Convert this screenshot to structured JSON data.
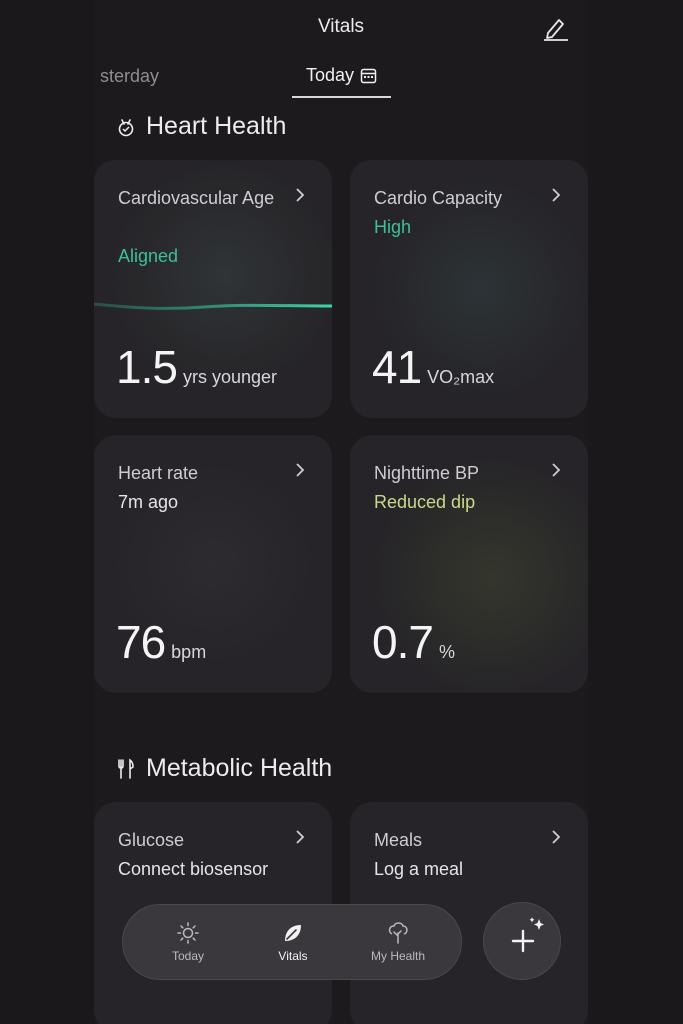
{
  "header": {
    "title": "Vitals",
    "edit_icon": "pencil-icon"
  },
  "day_tabs": {
    "yesterday": "sterday",
    "today": "Today"
  },
  "heart_health": {
    "title": "Heart Health",
    "icon": "heart-health-icon",
    "cards": [
      {
        "title": "Cardiovascular Age",
        "status": "Aligned",
        "value": "1.5",
        "unit": "yrs younger"
      },
      {
        "title": "Cardio Capacity",
        "status": "High",
        "value": "41",
        "unit": "VO₂max"
      },
      {
        "title": "Heart rate",
        "status": "7m ago",
        "value": "76",
        "unit": "bpm"
      },
      {
        "title": "Nighttime BP",
        "status": "Reduced dip",
        "value": "0.7",
        "unit": "%"
      }
    ]
  },
  "metabolic_health": {
    "title": "Metabolic Health",
    "icon": "fork-knife-icon",
    "cards": [
      {
        "title": "Glucose",
        "status": "Connect biosensor"
      },
      {
        "title": "Meals",
        "status": "Log a meal"
      }
    ]
  },
  "nav": {
    "items": [
      {
        "label": "Today",
        "icon": "sun-icon"
      },
      {
        "label": "Vitals",
        "icon": "leaf-icon"
      },
      {
        "label": "My Health",
        "icon": "tree-icon"
      }
    ],
    "active": "Vitals",
    "fab_icon": "plus-sparkle-icon"
  },
  "colors": {
    "aligned": "#3dbf9a",
    "high": "#3dbf9a",
    "reduced_dip": "#c9d98a",
    "background": "#1c1a1d",
    "card": "#262428"
  }
}
